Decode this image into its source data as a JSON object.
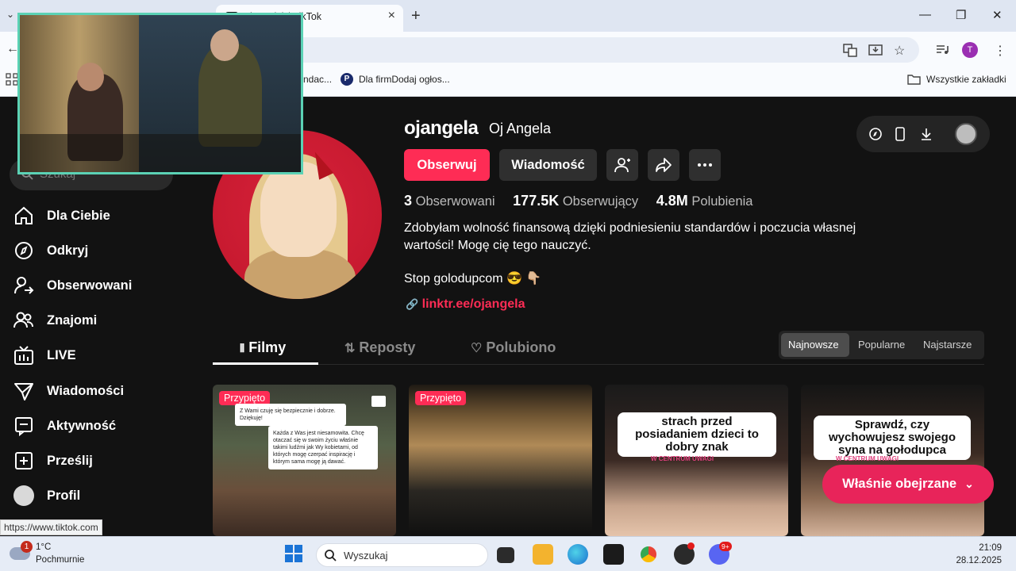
{
  "browser": {
    "active_tab_title": "ojangela) | TikTok",
    "tab_close": "×",
    "new_tab": "+",
    "window_controls": {
      "minimize": "—",
      "maximize": "❐",
      "close": "✕"
    },
    "avatar_letter": "T",
    "bookmarks": [
      {
        "label": "ndac..."
      },
      {
        "label": "Dla firmDodaj ogłos..."
      }
    ],
    "all_bookmarks_label": "Wszystkie zakładki",
    "status_url": "https://www.tiktok.com"
  },
  "sidebar": {
    "search_placeholder": "Szukaj",
    "items": [
      {
        "label": "Dla Ciebie",
        "icon": "home-icon"
      },
      {
        "label": "Odkryj",
        "icon": "compass-icon"
      },
      {
        "label": "Obserwowani",
        "icon": "following-icon"
      },
      {
        "label": "Znajomi",
        "icon": "friends-icon"
      },
      {
        "label": "LIVE",
        "icon": "live-icon"
      },
      {
        "label": "Wiadomości",
        "icon": "messages-icon"
      },
      {
        "label": "Aktywność",
        "icon": "activity-icon"
      },
      {
        "label": "Prześlij",
        "icon": "upload-icon"
      },
      {
        "label": "Profil",
        "icon": "profile-avatar"
      }
    ]
  },
  "profile": {
    "username": "ojangela",
    "nickname": "Oj Angela",
    "follow_label": "Obserwuj",
    "message_label": "Wiadomość",
    "stats": {
      "following_count": "3",
      "following_label": "Obserwowani",
      "followers_count": "177.5K",
      "followers_label": "Obserwujący",
      "likes_count": "4.8M",
      "likes_label": "Polubienia"
    },
    "bio_line1": "Zdobyłam wolność finansową dzięki podniesieniu standardów i poczucia własnej wartości! Mogę cię tego nauczyć.",
    "bio_line2": "Stop golodupcom 😎 👇🏼",
    "link": "linktr.ee/ojangela"
  },
  "content_tabs": [
    {
      "label": "Filmy"
    },
    {
      "label": "Reposty"
    },
    {
      "label": "Polubiono"
    }
  ],
  "sort": {
    "newest": "Najnowsze",
    "popular": "Popularne",
    "oldest": "Najstarsze"
  },
  "videos": [
    {
      "pinned": "Przypięto",
      "note1": "Z Wami czuję się bezpiecznie i dobrze. Dziękuję!",
      "note2": "Każda z Was jest niesamowita. Chcę otaczać się w swoim życiu właśnie takimi ludźmi jak Wy kobietami, od których mogę czerpać inspirację i którym sama mogę ją dawać."
    },
    {
      "pinned": "Przypięto"
    },
    {
      "caption": "strach przed posiadaniem dzieci to dobry znak",
      "sub": "W CENTRUM UWAGI"
    },
    {
      "caption": "Sprawdź, czy wychowujesz swojego syna na gołodupca",
      "sub": "W CENTRUM UWAGI"
    }
  ],
  "recently_watched": "Właśnie obejrzane",
  "taskbar": {
    "weather_temp": "1°C",
    "weather_desc": "Pochmurnie",
    "weather_badge": "1",
    "search_placeholder": "Wyszukaj",
    "time": "21:09",
    "date": "28.12.2025",
    "discord_badge": "9+"
  },
  "colors": {
    "accent": "#fe2c55",
    "camera_border": "#5bd2b5"
  }
}
